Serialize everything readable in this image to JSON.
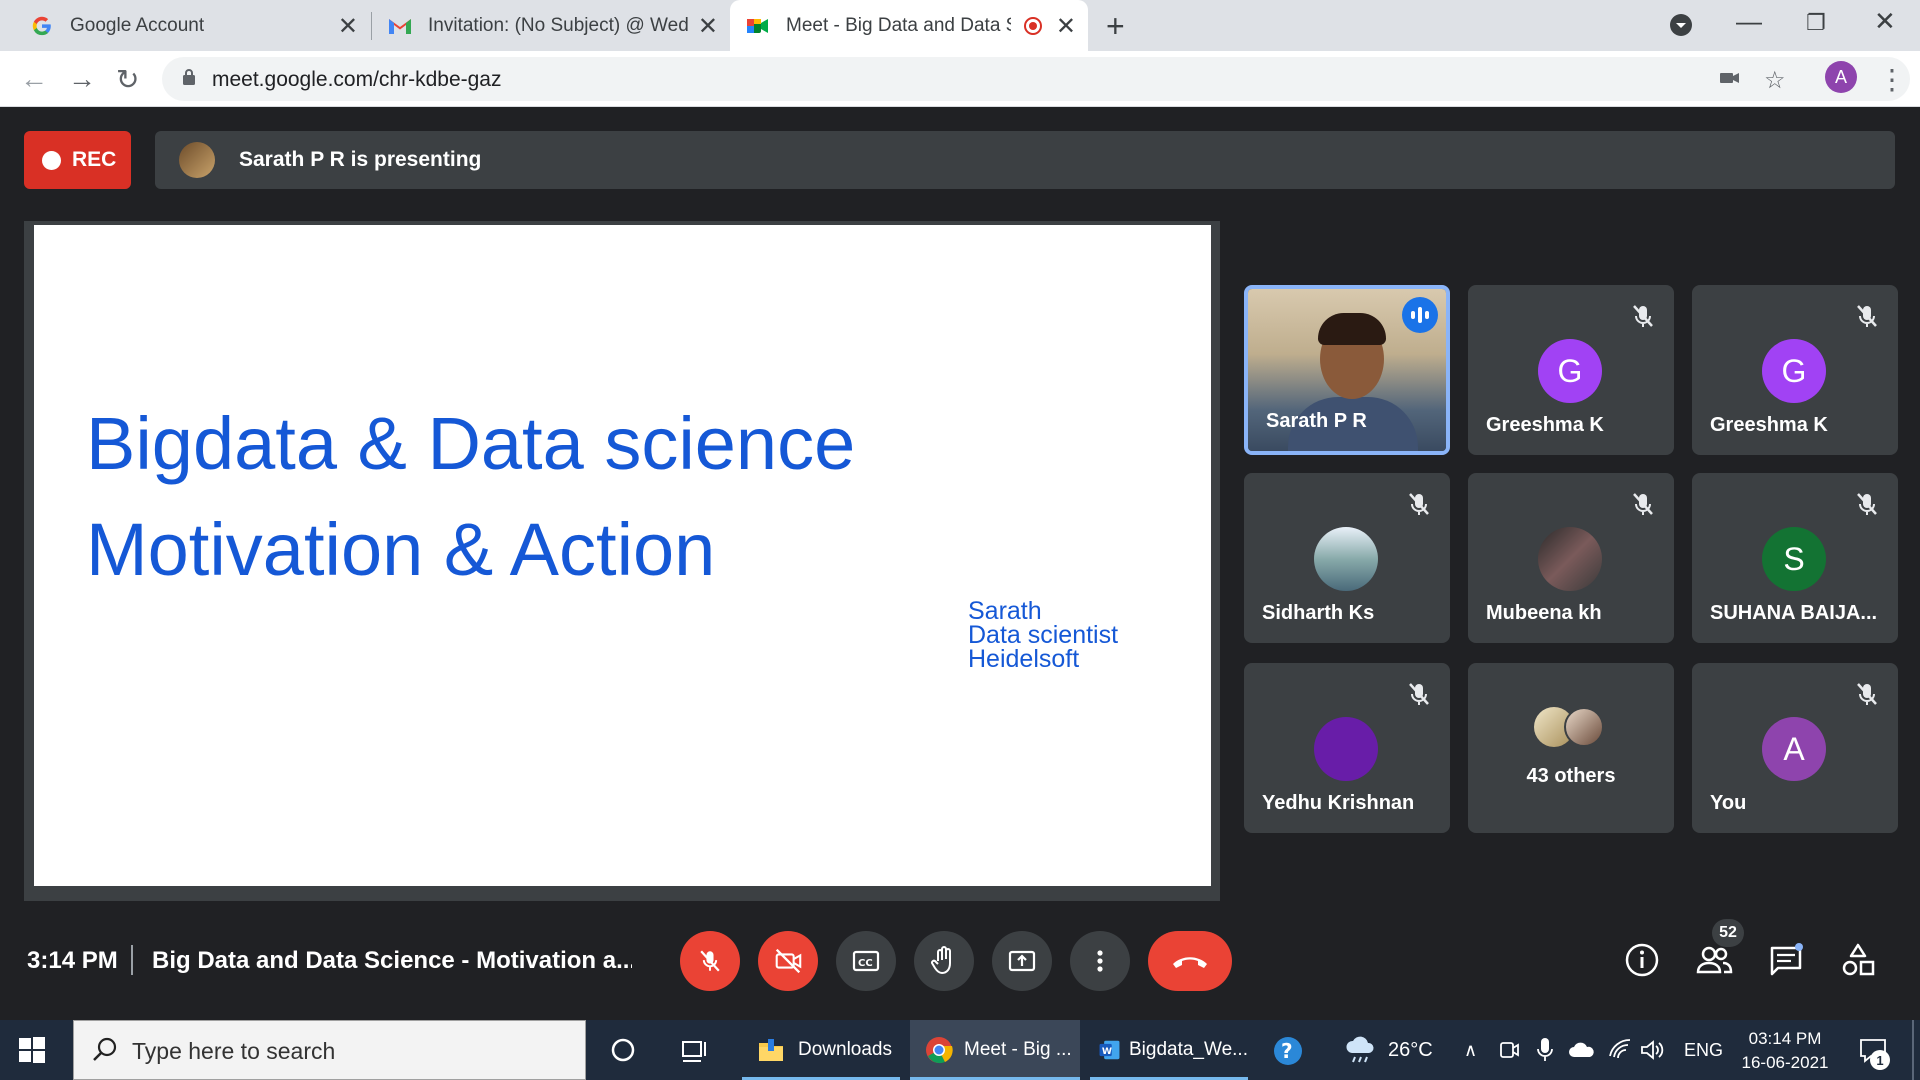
{
  "browser": {
    "tabs": [
      {
        "title": "Google Account",
        "favicon": "google-g-icon"
      },
      {
        "title": "Invitation: (No Subject) @ Wed Ju",
        "favicon": "gmail-icon"
      },
      {
        "title": "Meet - Big Data and Data Sc",
        "favicon": "meet-icon",
        "active": true
      }
    ],
    "url": "meet.google.com/chr-kdbe-gaz",
    "profile_initial": "A"
  },
  "meet": {
    "rec_label": "REC",
    "presenting_text": "Sarath P R is presenting",
    "slide": {
      "title_line1": "Bigdata & Data science",
      "title_line2": "Motivation & Action",
      "author_name": "Sarath",
      "author_role": "Data scientist",
      "author_company": "Heidelsoft"
    },
    "participants": [
      {
        "name": "Sarath P R",
        "type": "video",
        "speaking": true
      },
      {
        "name": "Greeshma K",
        "initial": "G",
        "color": "#a142f4",
        "muted": true
      },
      {
        "name": "Greeshma K",
        "initial": "G",
        "color": "#a142f4",
        "muted": true
      },
      {
        "name": "Sidharth Ks",
        "type": "photo",
        "muted": true
      },
      {
        "name": "Mubeena kh",
        "type": "photo",
        "muted": true
      },
      {
        "name": "SUHANA BAIJA...",
        "initial": "S",
        "color": "#137333",
        "muted": true
      },
      {
        "name": "Yedhu Krishnan",
        "initial": "",
        "color": "#681da8",
        "muted": true
      },
      {
        "name": "43 others",
        "type": "others"
      },
      {
        "name": "You",
        "initial": "A",
        "color": "#8e44ad",
        "muted": true
      }
    ],
    "time": "3:14 PM",
    "meeting_title": "Big Data and Data Science - Motivation a...",
    "people_count": "52"
  },
  "taskbar": {
    "search_placeholder": "Type here to search",
    "apps": [
      {
        "label": "Downloads",
        "icon": "folder-icon"
      },
      {
        "label": "Meet - Big ...",
        "icon": "chrome-icon",
        "active": true
      },
      {
        "label": "Bigdata_We...",
        "icon": "word-icon"
      }
    ],
    "weather": "26°C",
    "language": "ENG",
    "clock_time": "03:14 PM",
    "clock_date": "16-06-2021",
    "notification_count": "1"
  }
}
